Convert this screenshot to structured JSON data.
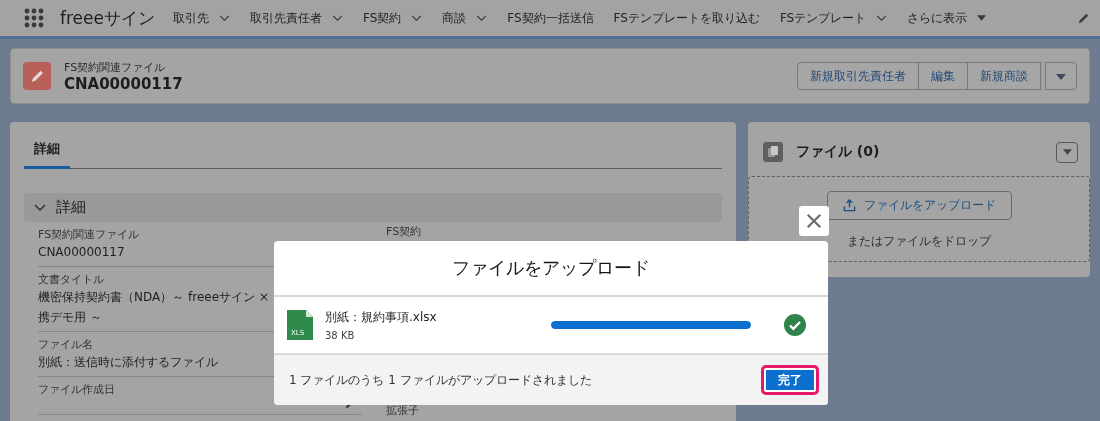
{
  "navbar": {
    "app_name": "freeeサイン",
    "items": [
      {
        "label": "取引先",
        "kind": "menu"
      },
      {
        "label": "取引先責任者",
        "kind": "menu"
      },
      {
        "label": "FS契約",
        "kind": "menu"
      },
      {
        "label": "商談",
        "kind": "menu"
      },
      {
        "label": "FS契約一括送信",
        "kind": "plain"
      },
      {
        "label": "FSテンプレートを取り込む",
        "kind": "plain"
      },
      {
        "label": "FSテンプレート",
        "kind": "menu"
      },
      {
        "label": "さらに表示",
        "kind": "more"
      }
    ]
  },
  "record_header": {
    "object_type": "FS契約関連ファイル",
    "record_name": "CNA00000117",
    "actions": [
      "新規取引先責任者",
      "編集",
      "新規商談"
    ]
  },
  "detail_card": {
    "tabs": [
      {
        "label": "詳細",
        "selected": true
      }
    ],
    "section": {
      "title": "詳細",
      "expanded": true
    },
    "fields_left": [
      {
        "label": "FS契約関連ファイル",
        "value": [
          "CNA00000117"
        ]
      },
      {
        "label": "文書タイトル",
        "value": [
          "機密保持契約書（NDA）～ freeeサイン ×",
          "携デモ用 ～"
        ]
      },
      {
        "label": "ファイル名",
        "value": [
          "別紙：送信時に添付するファイル"
        ]
      },
      {
        "label": "ファイル作成日",
        "editable": true
      }
    ],
    "fields_right": [
      {
        "label": "FS契約"
      },
      {
        "label": "拡張子"
      }
    ]
  },
  "files_card": {
    "title": "ファイル (0)",
    "upload_button": "ファイルをアップロード",
    "drop_hint": "またはファイルをドロップ"
  },
  "upload_modal": {
    "title": "ファイルをアップロード",
    "files": [
      {
        "name": "別紙：規約事項.xlsx",
        "size": "38 KB",
        "file_type": "XLS",
        "level": 1,
        "done": true
      }
    ],
    "status": "1 ファイルのうち 1 ファイルがアップロードされました",
    "done_button": {
      "label": "完了",
      "focused": true
    }
  }
}
